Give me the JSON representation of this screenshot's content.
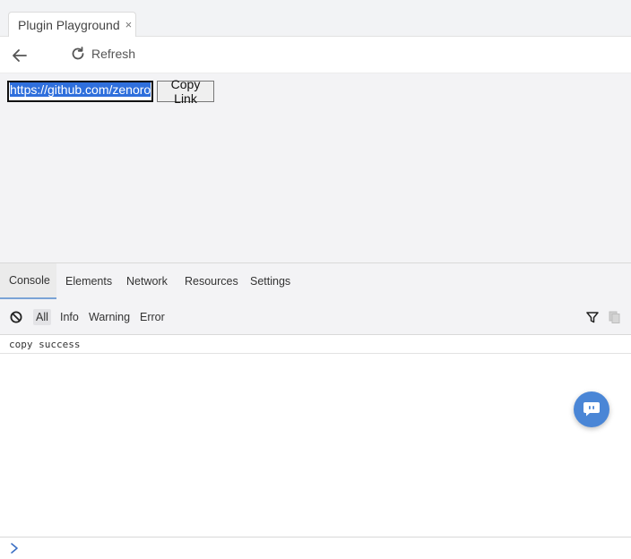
{
  "tab": {
    "title": "Plugin Playground",
    "close": "×"
  },
  "toolbar": {
    "refresh_label": "Refresh"
  },
  "content": {
    "url_value": "https://github.com/zenoro",
    "copy_button": "Copy Link"
  },
  "devtools": {
    "tabs": [
      "Console",
      "Elements",
      "Network",
      "Resources",
      "Settings"
    ],
    "active_tab": "Console",
    "filters": [
      "All",
      "Info",
      "Warning",
      "Error"
    ],
    "active_filter": "All",
    "log_lines": [
      "copy success"
    ]
  },
  "icons": {
    "back": "back-arrow-icon",
    "refresh": "refresh-icon",
    "clear": "clear-console-icon",
    "filter": "funnel-icon",
    "copy": "copy-icon",
    "chat": "chat-bubble-icon",
    "prompt": "chevron-right-icon"
  },
  "colors": {
    "accent": "#4a86d6",
    "selection": "#2f6fdc"
  }
}
